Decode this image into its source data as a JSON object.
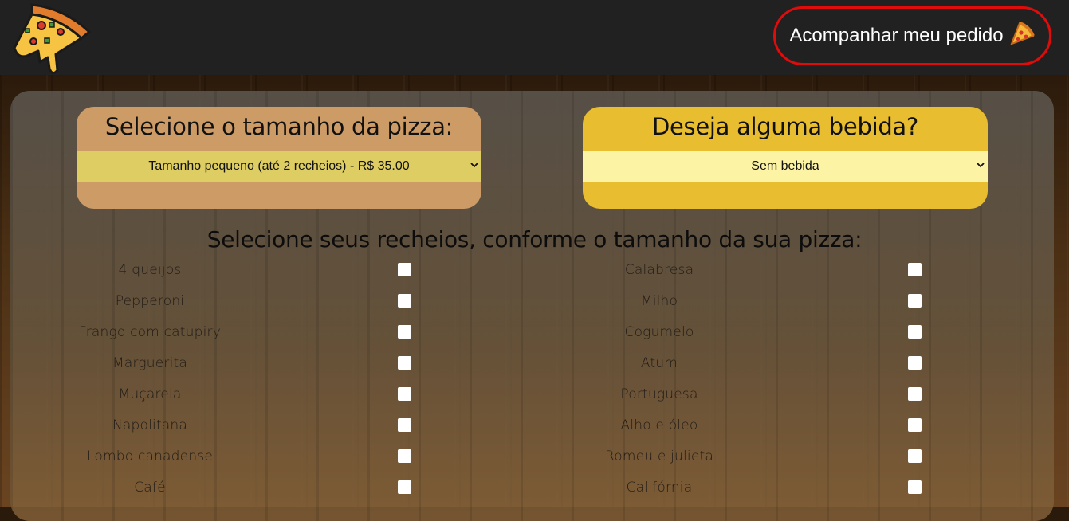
{
  "header": {
    "track_order_label": "Acompanhar meu pedido"
  },
  "size_card": {
    "title": "Selecione o tamanho da pizza:",
    "selected": "Tamanho pequeno (até 2 recheios) - R$ 35.00"
  },
  "drink_card": {
    "title": "Deseja alguma bebida?",
    "selected": "Sem bebida"
  },
  "fillings": {
    "title": "Selecione seus recheios, conforme o tamanho da sua pizza:",
    "left": [
      "4 queijos",
      "Pepperoni",
      "Frango com catupiry",
      "Marguerita",
      "Muçarela",
      "Napolitana",
      "Lombo canadense",
      "Café"
    ],
    "right": [
      "Calabresa",
      "Milho",
      "Cogumelo",
      "Atum",
      "Portuguesa",
      "Alho e óleo",
      "Romeu e julieta",
      "Califórnia"
    ],
    "checked_left": [
      false,
      false,
      false,
      false,
      false,
      false,
      false,
      false
    ],
    "checked_right": [
      false,
      false,
      false,
      false,
      false,
      false,
      false,
      false
    ]
  },
  "colors": {
    "header_bg": "#212121",
    "track_border": "#e00b0b",
    "size_card_bg": "#cd9b66",
    "size_select_bg": "#decd62",
    "drink_card_bg": "#e8bd30",
    "drink_select_bg": "#fdf3a5"
  }
}
